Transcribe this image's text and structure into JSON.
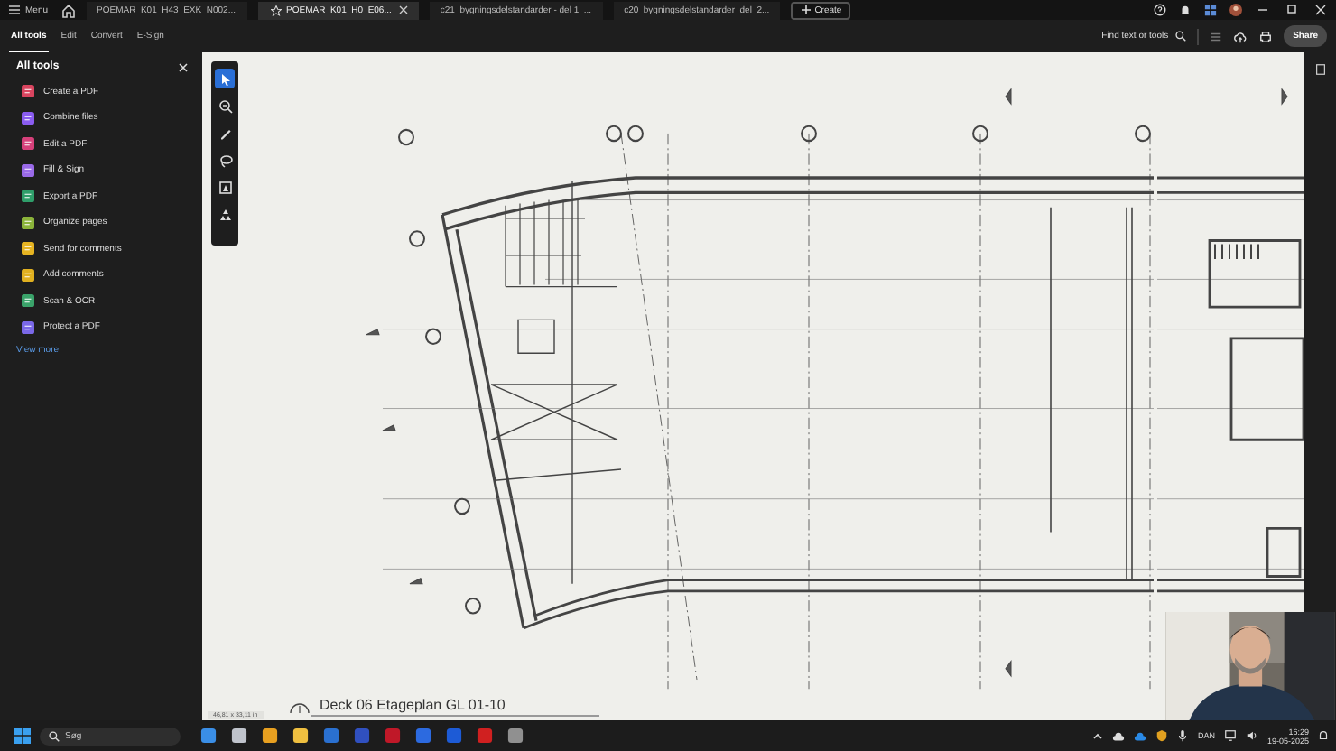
{
  "menu": {
    "label": "Menu"
  },
  "doc_tabs": [
    {
      "label": "POEMAR_K01_H43_EXK_N002...",
      "selected": false,
      "starred": false
    },
    {
      "label": "POEMAR_K01_H0_E06...",
      "selected": true,
      "starred": true
    },
    {
      "label": "c21_bygningsdelstandarder - del 1_...",
      "selected": false,
      "starred": false
    },
    {
      "label": "c20_bygningsdelstandarder_del_2...",
      "selected": false,
      "starred": false
    }
  ],
  "create_button": "Create",
  "toolbar_tabs": [
    {
      "label": "All tools",
      "selected": true
    },
    {
      "label": "Edit",
      "selected": false
    },
    {
      "label": "Convert",
      "selected": false
    },
    {
      "label": "E-Sign",
      "selected": false
    }
  ],
  "search": {
    "placeholder": "Find text or tools"
  },
  "share_button": "Share",
  "panel": {
    "title": "All tools",
    "tools": [
      {
        "label": "Create a PDF",
        "color": "#d9455f"
      },
      {
        "label": "Combine files",
        "color": "#8a5cf0"
      },
      {
        "label": "Edit a PDF",
        "color": "#d6407a"
      },
      {
        "label": "Fill & Sign",
        "color": "#9a6ae8"
      },
      {
        "label": "Export a PDF",
        "color": "#2f9e6a"
      },
      {
        "label": "Organize pages",
        "color": "#8bb33a"
      },
      {
        "label": "Send for comments",
        "color": "#e6b422"
      },
      {
        "label": "Add comments",
        "color": "#e0b020"
      },
      {
        "label": "Scan & OCR",
        "color": "#3aa36a"
      },
      {
        "label": "Protect a PDF",
        "color": "#7a68e8"
      }
    ],
    "view_more": "View more"
  },
  "canvas_tools": [
    {
      "kind": "select",
      "selected": true
    },
    {
      "kind": "zoom",
      "selected": false
    },
    {
      "kind": "pen",
      "selected": false
    },
    {
      "kind": "lasso",
      "selected": false
    },
    {
      "kind": "stamp",
      "selected": false
    },
    {
      "kind": "measure",
      "selected": false
    }
  ],
  "canvas_more": "...",
  "sheet": {
    "caption": "Deck 06 Etageplan GL 01-10",
    "page_size": "46,81 x 33,11 in"
  },
  "taskbar": {
    "search_placeholder": "Søg",
    "language": "DAN",
    "time": "16:29",
    "date": "19-05-2025"
  }
}
